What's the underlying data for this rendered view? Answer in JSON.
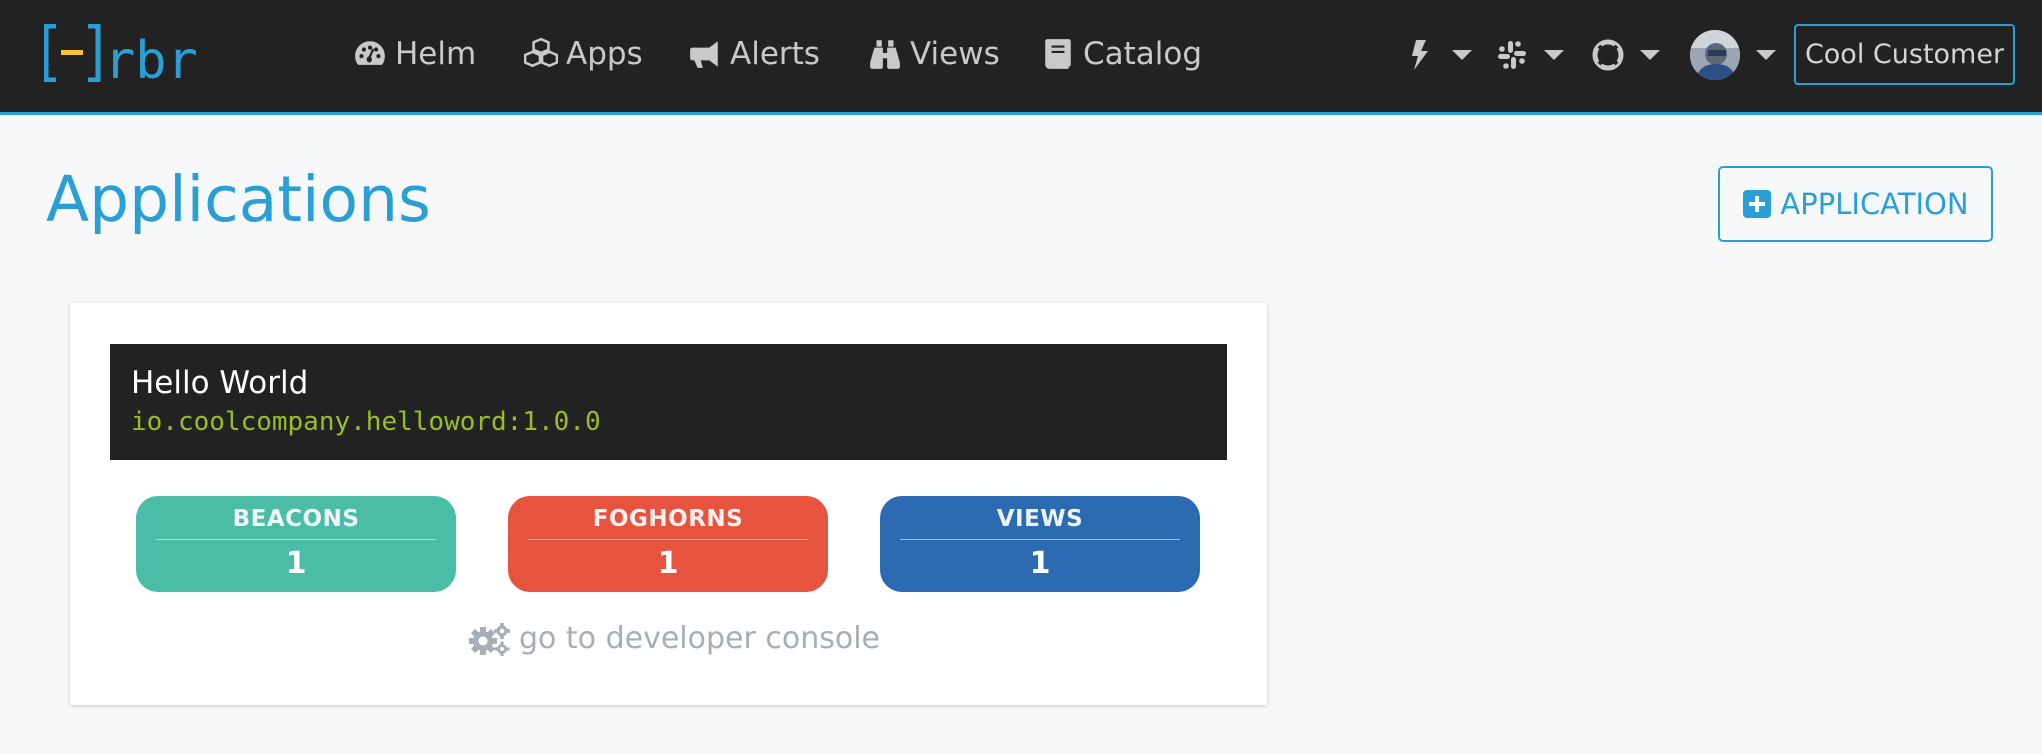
{
  "navbar": {
    "logo_text": "[–]rbr",
    "items": [
      {
        "label": "Helm",
        "icon": "dashboard-gauge-icon"
      },
      {
        "label": "Apps",
        "icon": "cubes-icon"
      },
      {
        "label": "Alerts",
        "icon": "megaphone-icon"
      },
      {
        "label": "Views",
        "icon": "binoculars-icon"
      },
      {
        "label": "Catalog",
        "icon": "book-icon"
      }
    ],
    "dropdowns": [
      {
        "icon": "bolt-icon"
      },
      {
        "icon": "slack-icon"
      },
      {
        "icon": "lifebuoy-icon"
      },
      {
        "icon": "user-avatar"
      }
    ],
    "customer_label": "Cool Customer"
  },
  "page": {
    "title": "Applications",
    "add_button_label": "APPLICATION"
  },
  "app_card": {
    "name": "Hello World",
    "identifier": "io.coolcompany.helloword:1.0.0",
    "stats": [
      {
        "label": "BEACONS",
        "count": "1",
        "color": "#4bbca6"
      },
      {
        "label": "FOGHORNS",
        "count": "1",
        "color": "#e6533e"
      },
      {
        "label": "VIEWS",
        "count": "1",
        "color": "#2c6bb1"
      }
    ],
    "dev_console_label": "go to developer console"
  },
  "colors": {
    "accent": "#2a9fd6",
    "navbar_bg": "#222222",
    "page_bg": "#f7f8fa",
    "identifier_green": "#97bf24",
    "logo_yellow": "#f6c23e"
  }
}
